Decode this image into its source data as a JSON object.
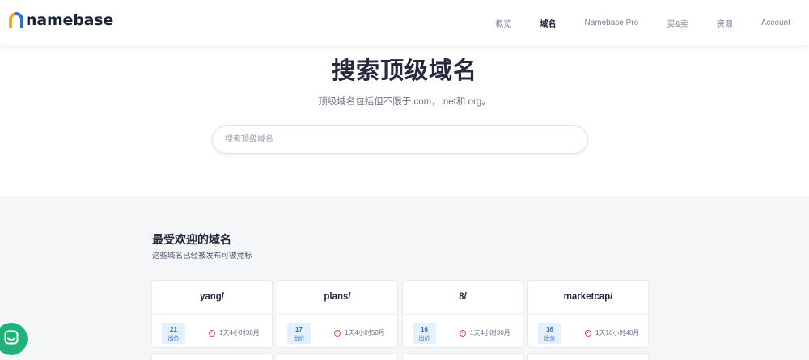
{
  "brand": {
    "name": "namebase"
  },
  "nav": {
    "items": [
      {
        "label": "概览",
        "active": false
      },
      {
        "label": "域名",
        "active": true
      },
      {
        "label": "Namebase Pro",
        "active": false
      },
      {
        "label": "买&卖",
        "active": false
      },
      {
        "label": "资源",
        "active": false
      },
      {
        "label": "Account",
        "active": false
      }
    ]
  },
  "hero": {
    "title": "搜索顶级域名",
    "subtitle": "顶级域名包括但不限于.com，.net和.org。",
    "search_placeholder": "搜索顶级域名",
    "search_value": ""
  },
  "popular": {
    "title": "最受欢迎的域名",
    "subtitle": "这些域名已经被发布可被竞标",
    "cards": [
      {
        "name": "yang/",
        "bids": "21",
        "bid_label": "出价",
        "time_left": "1天4小时30月"
      },
      {
        "name": "plans/",
        "bids": "17",
        "bid_label": "出价",
        "time_left": "1天4小时50月"
      },
      {
        "name": "8/",
        "bids": "16",
        "bid_label": "出价",
        "time_left": "1天4小时30月"
      },
      {
        "name": "marketcap/",
        "bids": "16",
        "bid_label": "出价",
        "time_left": "1天16小时40月"
      }
    ]
  },
  "colors": {
    "accent": "#2f6fc4",
    "chat": "#1fb37a",
    "timer": "#e5484d",
    "logo_blue": "#2f6fdc",
    "logo_orange": "#f5a623"
  },
  "icons": {
    "timer": "clock-icon",
    "chat": "chat-icon"
  }
}
